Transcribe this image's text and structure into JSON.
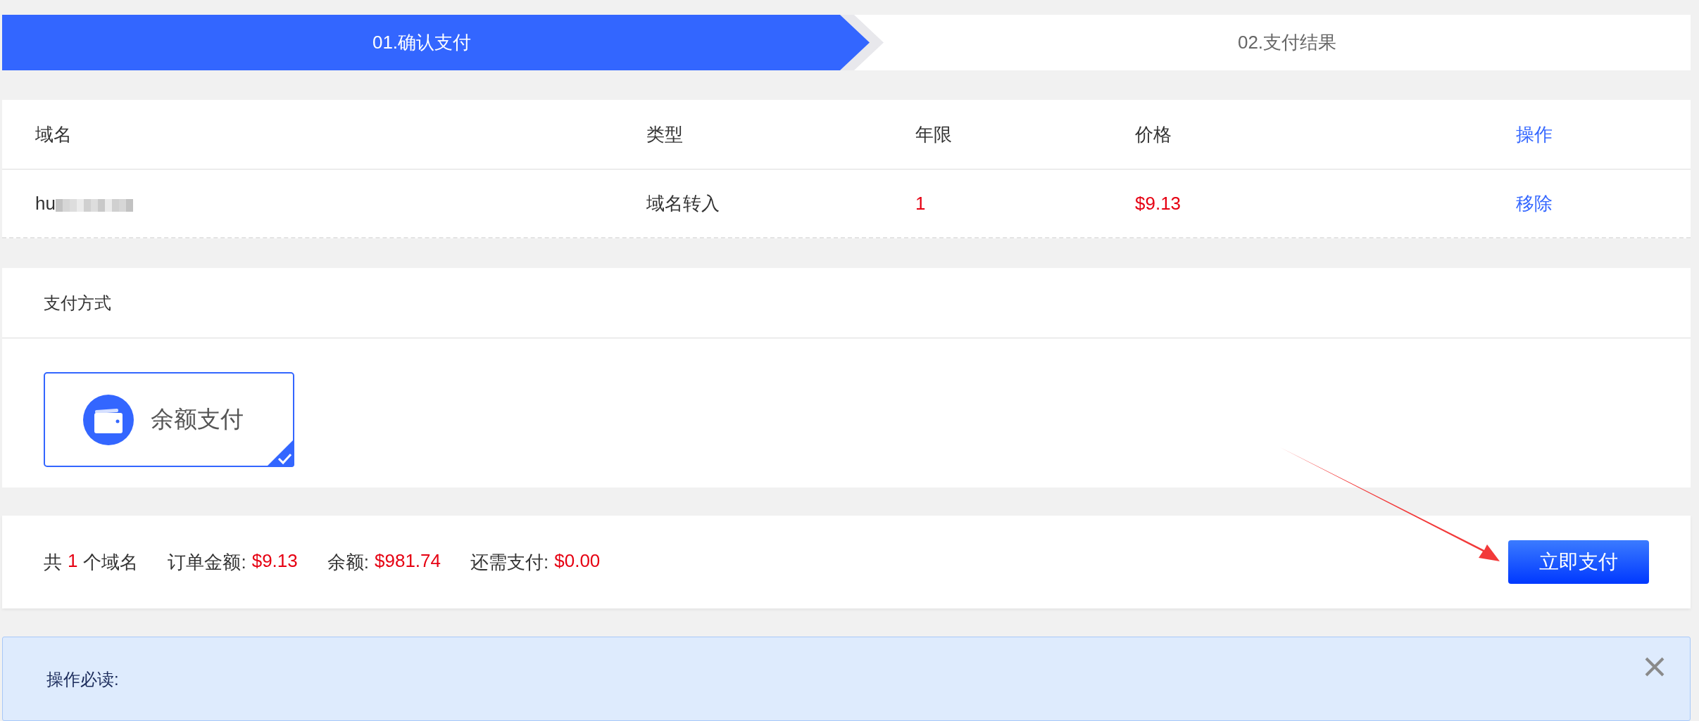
{
  "steps": [
    {
      "label": "01.确认支付",
      "selected": true
    },
    {
      "label": "02.支付结果",
      "selected": false
    }
  ],
  "table": {
    "columns": [
      "域名",
      "类型",
      "年限",
      "价格",
      "操作"
    ],
    "rows": [
      {
        "domain": "hu",
        "redacted": true,
        "type": "域名转入",
        "years": "1",
        "price": "$9.13",
        "action": "移除"
      }
    ]
  },
  "payment": {
    "title": "支付方式",
    "methods": [
      {
        "label": "余额支付",
        "selected": true
      }
    ]
  },
  "summary": [
    {
      "label": "共",
      "value": "1",
      "suffix": "个域名"
    },
    {
      "label": "订单金额:",
      "value": "$9.13"
    },
    {
      "label": "余额:",
      "value": "$981.74"
    },
    {
      "label": "还需支付:",
      "value": "$0.00"
    }
  ],
  "pay_button": "立即支付",
  "notice": {
    "title": "操作必读:"
  }
}
